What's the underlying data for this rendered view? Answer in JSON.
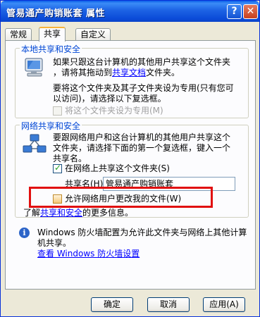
{
  "window": {
    "title": "管易通产购销账套 属性",
    "help_glyph": "?",
    "close_glyph": "✕"
  },
  "tabs": [
    {
      "label": "常规",
      "active": false
    },
    {
      "label": "共享",
      "active": true
    },
    {
      "label": "自定义",
      "active": false
    }
  ],
  "local": {
    "title": "本地共享和安全",
    "line1": "如果只跟这台计算机的其他用户共享这个文件夹",
    "line2_pre": "，请将其拖动到",
    "line2_link": "共享文档",
    "line2_post": "文件夹。",
    "line3": "要将这个文件夹及其子文件夹设为专用(只有您可",
    "line4": "以访问)，请选择以下复选框。",
    "private_label": "将这个文件夹设为专用(M)",
    "private_checked": false,
    "private_enabled": false
  },
  "network": {
    "title": "网络共享和安全",
    "line1": "要跟网络用户和这台计算机的其他用户共享这个",
    "line2": "文件夹，请选择下面的第一个复选框，键入一个",
    "line3": "共享名。",
    "share_label": "在网络上共享这个文件夹(S)",
    "share_checked": true,
    "share_name_label": "共享名(H):",
    "share_name_value": "管易通产购销账套",
    "allow_change_label": "允许网络用户更改我的文件(W)",
    "allow_change_checked": false,
    "learn_pre": "了解",
    "learn_link": "共享和安全",
    "learn_post": "的更多信息。"
  },
  "firewall": {
    "info_glyph": "i",
    "line1": "Windows 防火墙配置为允许此文件夹与网络上其他计算",
    "line2": "机共享。",
    "link": "查看 Windows 防火墙设置"
  },
  "buttons": {
    "ok": "确定",
    "cancel": "取消",
    "apply": "应用(A)"
  },
  "colors": {
    "titlebar": "#0b4bd8",
    "group_title": "#0046d5",
    "highlight": "#e10f0f",
    "link": "#0000ff"
  }
}
